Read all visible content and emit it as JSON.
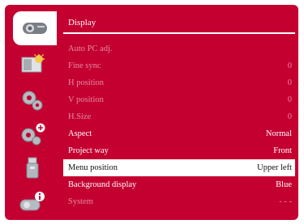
{
  "title": "Display",
  "sidebar": {
    "items": [
      {
        "name": "projector-icon",
        "active": true
      },
      {
        "name": "image-icon",
        "active": false
      },
      {
        "name": "gear-icon",
        "active": false
      },
      {
        "name": "gear-plus-icon",
        "active": false
      },
      {
        "name": "usb-drive-icon",
        "active": false
      },
      {
        "name": "projector-info-icon",
        "active": false
      }
    ]
  },
  "menu": {
    "items": [
      {
        "label": "Auto PC adj.",
        "value": "",
        "state": "disabled"
      },
      {
        "label": "Fine sync",
        "value": "0",
        "state": "disabled"
      },
      {
        "label": "H position",
        "value": "0",
        "state": "disabled"
      },
      {
        "label": "V position",
        "value": "0",
        "state": "disabled"
      },
      {
        "label": "H.Size",
        "value": "0",
        "state": "disabled"
      },
      {
        "label": "Aspect",
        "value": "Normal",
        "state": "enabled"
      },
      {
        "label": "Project way",
        "value": "Front",
        "state": "enabled"
      },
      {
        "label": "Menu position",
        "value": "Upper left",
        "state": "selected"
      },
      {
        "label": "Background display",
        "value": "Blue",
        "state": "enabled"
      },
      {
        "label": "System",
        "value": "- - -",
        "state": "disabled"
      }
    ]
  },
  "colors": {
    "frame": "#c40031",
    "disabled_text": "#e58a9f",
    "selected_bg": "#ffffff"
  }
}
